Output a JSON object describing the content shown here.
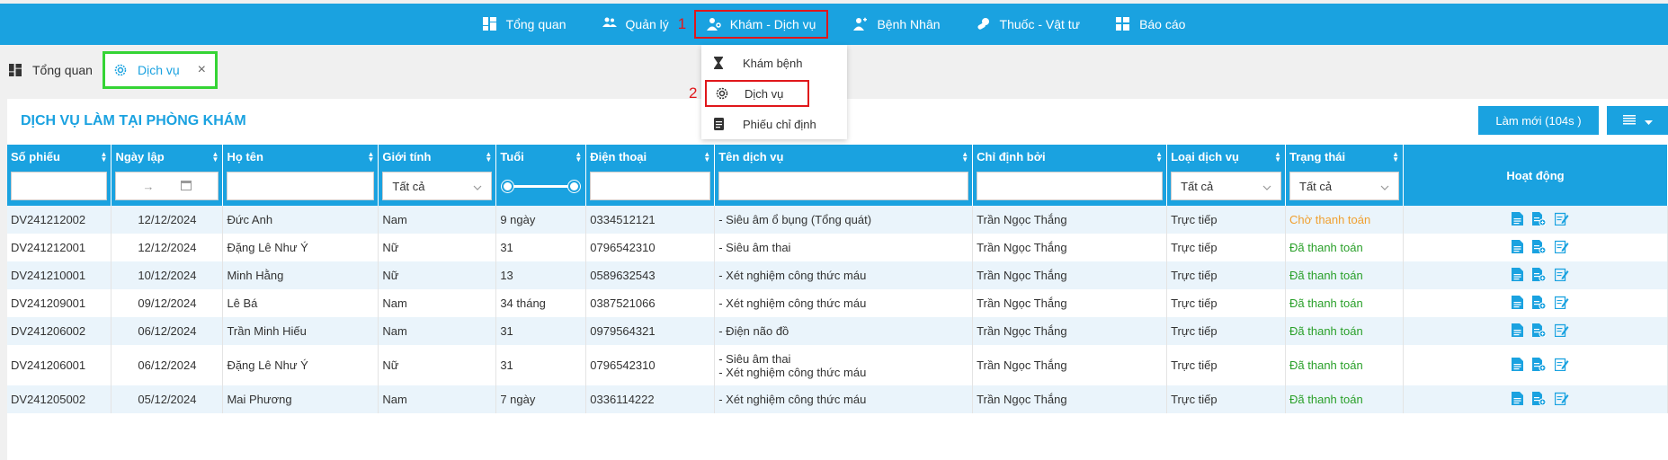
{
  "topnav": {
    "items": [
      {
        "label": "Tổng quan",
        "icon": "dashboard-icon"
      },
      {
        "label": "Quản lý",
        "icon": "users-icon"
      },
      {
        "label": "Khám - Dịch vụ",
        "icon": "doctor-icon"
      },
      {
        "label": "Bệnh Nhân",
        "icon": "patient-icon"
      },
      {
        "label": "Thuốc - Vật tư",
        "icon": "medicine-icon"
      },
      {
        "label": "Báo cáo",
        "icon": "report-icon"
      }
    ],
    "step1": "1",
    "step2": "2"
  },
  "tabs": {
    "home": "Tổng quan",
    "service": "Dịch vụ"
  },
  "dropdown": {
    "items": [
      "Khám bệnh",
      "Dịch vụ",
      "Phiếu chỉ định"
    ]
  },
  "page": {
    "title": "DỊCH VỤ LÀM TẠI PHÒNG KHÁM",
    "refresh": "Làm mới (104s )"
  },
  "table": {
    "headers": [
      "Số phiếu",
      "Ngày lập",
      "Họ tên",
      "Giới tính",
      "Tuổi",
      "Điện thoại",
      "Tên dịch vụ",
      "Chỉ định bởi",
      "Loại dịch vụ",
      "Trạng thái",
      "Hoạt động"
    ],
    "filters": {
      "gender": "Tất cả",
      "type": "Tất cả",
      "status": "Tất cả",
      "date_arrow": "→"
    },
    "rows": [
      {
        "id": "DV241212002",
        "date": "12/12/2024",
        "name": "Đức Anh",
        "gender": "Nam",
        "age": "9 ngày",
        "phone": "0334512121",
        "service": [
          "- Siêu âm ổ bụng (Tổng quát)"
        ],
        "doctor": "Trần Ngọc Thắng",
        "type": "Trực tiếp",
        "status": "Chờ thanh toán",
        "status_kind": "wait"
      },
      {
        "id": "DV241212001",
        "date": "12/12/2024",
        "name": "Đặng Lê Như Ý",
        "gender": "Nữ",
        "age": "31",
        "phone": "0796542310",
        "service": [
          "- Siêu âm thai"
        ],
        "doctor": "Trần Ngọc Thắng",
        "type": "Trực tiếp",
        "status": "Đã thanh toán",
        "status_kind": "paid"
      },
      {
        "id": "DV241210001",
        "date": "10/12/2024",
        "name": "Minh Hằng",
        "gender": "Nữ",
        "age": "13",
        "phone": "0589632543",
        "service": [
          "- Xét nghiệm công thức máu"
        ],
        "doctor": "Trần Ngọc Thắng",
        "type": "Trực tiếp",
        "status": "Đã thanh toán",
        "status_kind": "paid"
      },
      {
        "id": "DV241209001",
        "date": "09/12/2024",
        "name": "Lê Bá",
        "gender": "Nam",
        "age": "34 tháng",
        "phone": "0387521066",
        "service": [
          "- Xét nghiệm công thức máu"
        ],
        "doctor": "Trần Ngọc Thắng",
        "type": "Trực tiếp",
        "status": "Đã thanh toán",
        "status_kind": "paid"
      },
      {
        "id": "DV241206002",
        "date": "06/12/2024",
        "name": "Trần Minh Hiếu",
        "gender": "Nam",
        "age": "31",
        "phone": "0979564321",
        "service": [
          "- Điện não đồ"
        ],
        "doctor": "Trần Ngọc Thắng",
        "type": "Trực tiếp",
        "status": "Đã thanh toán",
        "status_kind": "paid"
      },
      {
        "id": "DV241206001",
        "date": "06/12/2024",
        "name": "Đặng Lê Như Ý",
        "gender": "Nữ",
        "age": "31",
        "phone": "0796542310",
        "service": [
          "- Siêu âm thai",
          "- Xét nghiệm công thức máu"
        ],
        "doctor": "Trần Ngọc Thắng",
        "type": "Trực tiếp",
        "status": "Đã thanh toán",
        "status_kind": "paid"
      },
      {
        "id": "DV241205002",
        "date": "05/12/2024",
        "name": "Mai Phương",
        "gender": "Nam",
        "age": "7 ngày",
        "phone": "0336114222",
        "service": [
          "- Xét nghiệm công thức máu"
        ],
        "doctor": "Trần Ngọc Thắng",
        "type": "Trực tiếp",
        "status": "Đã thanh toán",
        "status_kind": "paid"
      }
    ]
  },
  "colors": {
    "primary": "#1aa2e0",
    "highlight": "#e0171b",
    "tab_highlight": "#35d435",
    "paid": "#2aa02a",
    "wait": "#f0a030"
  }
}
